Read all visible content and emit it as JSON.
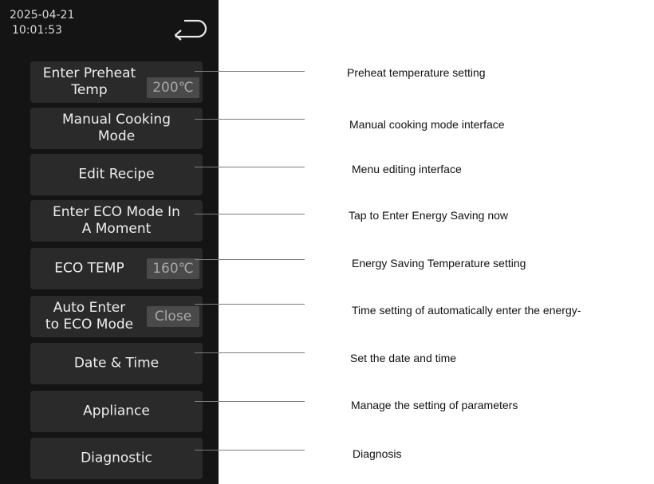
{
  "header": {
    "date": "2025-04-21",
    "time": "10:01:53",
    "back_icon": "return-arrow-icon"
  },
  "menu": [
    {
      "label": "Enter Preheat\nTemp",
      "value": "200℃",
      "description": "Preheat temperature setting"
    },
    {
      "label": "Manual Cooking\nMode",
      "description": "Manual cooking mode interface"
    },
    {
      "label": "Edit Recipe",
      "description": "Menu editing interface"
    },
    {
      "label": "Enter ECO Mode In\nA Moment",
      "description": "Tap to Enter Energy Saving now"
    },
    {
      "label": "ECO TEMP",
      "value": "160℃",
      "description": "Energy Saving Temperature setting"
    },
    {
      "label": "Auto Enter\nto ECO Mode",
      "value": "Close",
      "description": "Time setting of automatically enter the energy-"
    },
    {
      "label": "Date & Time",
      "description": "Set the date and time"
    },
    {
      "label": "Appliance",
      "description": "Manage the setting of parameters"
    },
    {
      "label": "Diagnostic",
      "description": "Diagnosis"
    }
  ],
  "colors": {
    "panel_bg": "#141414",
    "button_bg": "#2a2a2a",
    "value_box_bg": "#4a4a4a"
  }
}
